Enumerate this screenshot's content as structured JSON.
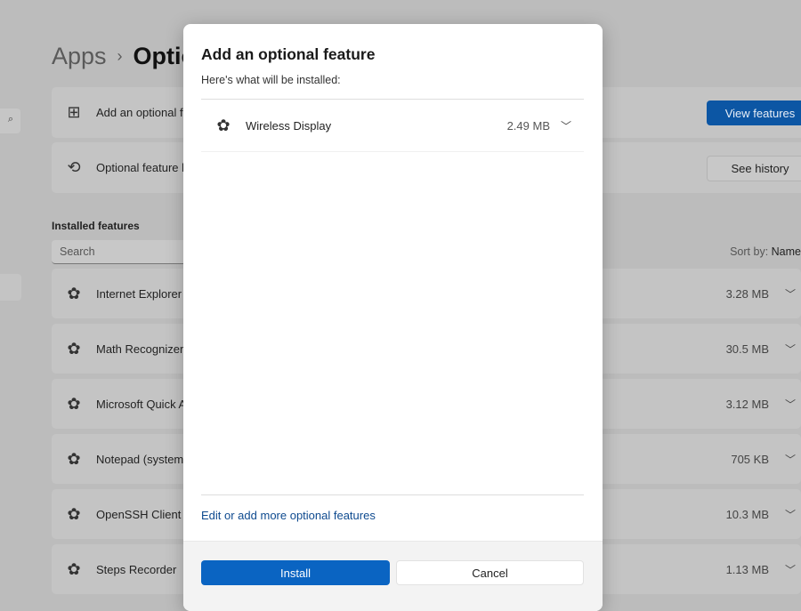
{
  "breadcrumb": {
    "parent": "Apps",
    "separator": "›",
    "current": "Optional features"
  },
  "cards": [
    {
      "icon": "add-grid-icon",
      "label": "Add an optional feature",
      "button": "View features"
    },
    {
      "icon": "history-icon",
      "label": "Optional feature history",
      "button": "See history"
    }
  ],
  "installed": {
    "title": "Installed features",
    "search_placeholder": "Search",
    "sort_label": "Sort by:",
    "sort_value": "Name",
    "items": [
      {
        "name": "Internet Explorer mode",
        "size": "3.28 MB"
      },
      {
        "name": "Math Recognizer",
        "size": "30.5 MB"
      },
      {
        "name": "Microsoft Quick Assist",
        "size": "3.12 MB"
      },
      {
        "name": "Notepad (system)",
        "size": "705 KB"
      },
      {
        "name": "OpenSSH Client",
        "size": "10.3 MB"
      },
      {
        "name": "Steps Recorder",
        "size": "1.13 MB"
      }
    ]
  },
  "dialog": {
    "title": "Add an optional feature",
    "subtitle": "Here's what will be installed:",
    "feature": {
      "name": "Wireless Display",
      "size": "2.49 MB"
    },
    "link": "Edit or add more optional features",
    "install": "Install",
    "cancel": "Cancel"
  },
  "colors": {
    "accent": "#0a64c2",
    "link": "#0e4a8f"
  }
}
